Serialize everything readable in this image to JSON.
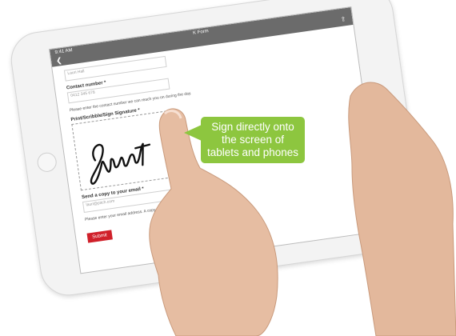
{
  "statusbar": {
    "time": "9:41 AM",
    "title": "K Form"
  },
  "form": {
    "name_value": "Lauri Hall",
    "contact_label": "Contact number *",
    "contact_value": "0412 345 678",
    "contact_note": "Please enter the contact number we can reach you on during the day.",
    "signature_label": "Print/Scribble/Sign Signature *",
    "signature_text": "Shurt",
    "copy_label": "Send a copy to your email *",
    "copy_value": "lauri@pitch.com",
    "copy_note": "Please enter your email address. A copy of the form will be sent.",
    "submit_label": "Submit"
  },
  "callout": {
    "line1": "Sign directly onto",
    "line2": "the screen of",
    "line3": "tablets and phones",
    "color": "#8dc63f"
  },
  "icons": [
    "back-chevron-icon",
    "share-icon",
    "refresh-icon"
  ]
}
